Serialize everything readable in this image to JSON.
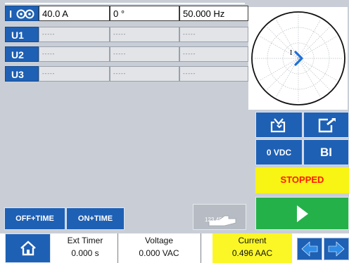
{
  "table": {
    "rows": [
      {
        "label": "",
        "icon": "current-clamp-icon",
        "cells": [
          "40.0 A",
          "0 °",
          "50.000 Hz"
        ]
      },
      {
        "label": "U1",
        "cells": [
          "-----",
          "-----",
          "-----"
        ]
      },
      {
        "label": "U2",
        "cells": [
          "-----",
          "-----",
          "-----"
        ]
      },
      {
        "label": "U3",
        "cells": [
          "-----",
          "-----",
          "-----"
        ]
      }
    ]
  },
  "phasor": {
    "label": "I",
    "angle_deg": 0
  },
  "buttons": {
    "import_icon": "import-icon",
    "edit_icon": "edit-icon",
    "vdc_label": "0 VDC",
    "bi_label": "BI",
    "status": "STOPPED",
    "play_icon": "play-icon",
    "off_time": "OFF+TIME",
    "on_time": "ON+TIME",
    "manual_value": "123.45"
  },
  "bottom": {
    "home_icon": "home-icon",
    "ext_timer": {
      "title": "Ext Timer",
      "value": "0.000 s"
    },
    "voltage": {
      "title": "Voltage",
      "value": "0.000 VAC"
    },
    "current": {
      "title": "Current",
      "value": "0.496 AAC"
    },
    "left_icon": "arrow-left-icon",
    "right_icon": "arrow-right-icon"
  },
  "colors": {
    "accent": "#1e60b4",
    "status_bg": "#f8f414",
    "status_text": "#ff1a00",
    "play": "#25b14a",
    "background": "#c9ced6"
  }
}
